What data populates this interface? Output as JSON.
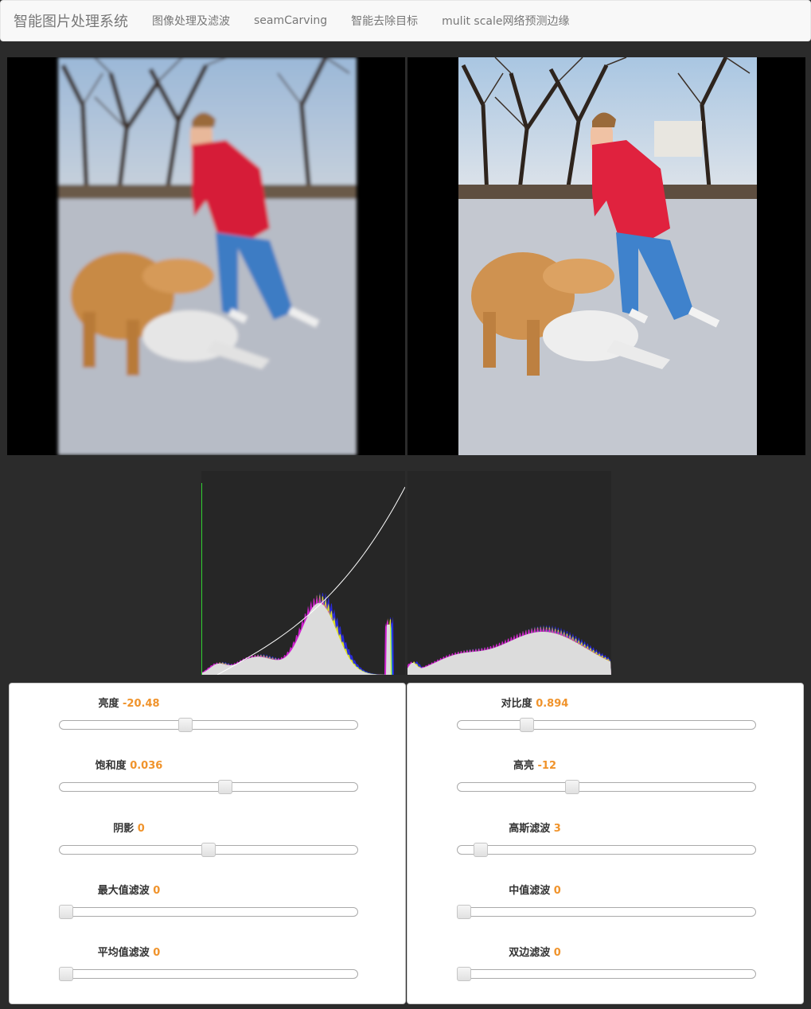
{
  "nav": {
    "brand": "智能图片处理系统",
    "items": [
      "图像处理及滤波",
      "seamCarving",
      "智能去除目标",
      "mulit scale网络预测边缘"
    ]
  },
  "images": {
    "left_alt": "Processed photo of a boy in a red jacket playing with two dogs in the snow (blurred)",
    "right_alt": "Original photo of a boy in a red jacket playing with two dogs in the snow"
  },
  "controls_left": [
    {
      "label": "亮度",
      "value": "-20.48",
      "level": 0.42
    },
    {
      "label": "饱和度",
      "value": "0.036",
      "level": 0.56
    },
    {
      "label": "阴影",
      "value": "0",
      "level": 0.5
    },
    {
      "label": "最大值滤波",
      "value": "0",
      "level": 0.0
    },
    {
      "label": "平均值滤波",
      "value": "0",
      "level": 0.0
    }
  ],
  "controls_right": [
    {
      "label": "对比度",
      "value": "0.894",
      "level": 0.22
    },
    {
      "label": "高亮",
      "value": "-12",
      "level": 0.38
    },
    {
      "label": "高斯滤波",
      "value": "3",
      "level": 0.06
    },
    {
      "label": "中值滤波",
      "value": "0",
      "level": 0.0
    },
    {
      "label": "双边滤波",
      "value": "0",
      "level": 0.0
    }
  ],
  "colors": {
    "value_accent": "#f0932b",
    "page_bg": "#2b2b2b",
    "histogram_bg": "#262626"
  }
}
